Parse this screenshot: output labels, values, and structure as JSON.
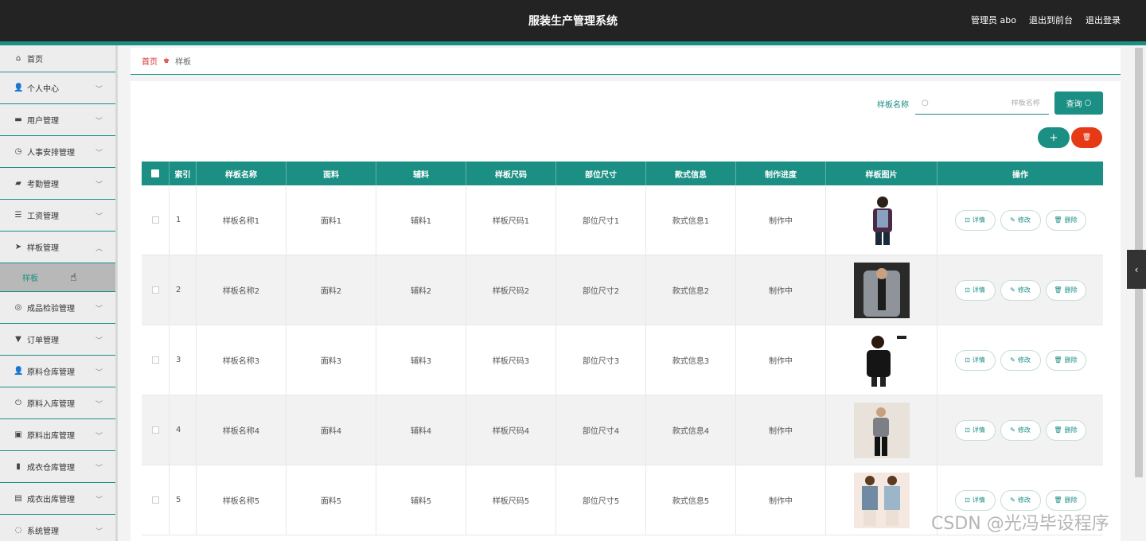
{
  "app": {
    "title": "服装生产管理系统"
  },
  "top_actions": {
    "user": "管理员 abo",
    "front": "退出到前台",
    "logout": "退出登录"
  },
  "sidebar": {
    "items": [
      {
        "label": "首页",
        "icon": "home-icon",
        "glyph": "⌂"
      },
      {
        "label": "个人中心",
        "icon": "user-icon",
        "glyph": "👤"
      },
      {
        "label": "用户管理",
        "icon": "users-icon",
        "glyph": "▬"
      },
      {
        "label": "人事安排管理",
        "icon": "clock-icon",
        "glyph": "◷"
      },
      {
        "label": "考勤管理",
        "icon": "chat-icon",
        "glyph": "▰"
      },
      {
        "label": "工资管理",
        "icon": "list-icon",
        "glyph": "☰"
      },
      {
        "label": "样板管理",
        "icon": "send-icon",
        "glyph": "➤"
      },
      {
        "label": "成品检验管理",
        "icon": "target-icon",
        "glyph": "◎"
      },
      {
        "label": "订单管理",
        "icon": "stamp-icon",
        "glyph": "▼"
      },
      {
        "label": "原料仓库管理",
        "icon": "person-icon",
        "glyph": "👤"
      },
      {
        "label": "原料入库管理",
        "icon": "power-icon",
        "glyph": "⏻"
      },
      {
        "label": "原料出库管理",
        "icon": "box-icon",
        "glyph": "▣"
      },
      {
        "label": "成衣仓库管理",
        "icon": "bar-chart-icon",
        "glyph": "▮"
      },
      {
        "label": "成衣出库管理",
        "icon": "clipboard-icon",
        "glyph": "▤"
      },
      {
        "label": "系统管理",
        "icon": "settings-icon",
        "glyph": "◌"
      }
    ],
    "sub_item": "样板"
  },
  "breadcrumb": {
    "home": "首页",
    "current": "样板"
  },
  "search": {
    "label": "样板名称",
    "placeholder": "样板名称",
    "button": "查询"
  },
  "buttons": {
    "add": "+",
    "delete": "🗑"
  },
  "table": {
    "headers": [
      "索引",
      "样板名称",
      "面料",
      "辅料",
      "样板尺码",
      "部位尺寸",
      "款式信息",
      "制作进度",
      "样板图片",
      "操作"
    ],
    "rows": [
      {
        "index": "1",
        "name": "样板名称1",
        "fabric": "面料1",
        "accessory": "辅料1",
        "size": "样板尺码1",
        "part": "部位尺寸1",
        "style": "款式信息1",
        "progress": "制作中"
      },
      {
        "index": "2",
        "name": "样板名称2",
        "fabric": "面料2",
        "accessory": "辅料2",
        "size": "样板尺码2",
        "part": "部位尺寸2",
        "style": "款式信息2",
        "progress": "制作中"
      },
      {
        "index": "3",
        "name": "样板名称3",
        "fabric": "面料3",
        "accessory": "辅料3",
        "size": "样板尺码3",
        "part": "部位尺寸3",
        "style": "款式信息3",
        "progress": "制作中"
      },
      {
        "index": "4",
        "name": "样板名称4",
        "fabric": "面料4",
        "accessory": "辅料4",
        "size": "样板尺码4",
        "part": "部位尺寸4",
        "style": "款式信息4",
        "progress": "制作中"
      },
      {
        "index": "5",
        "name": "样板名称5",
        "fabric": "面料5",
        "accessory": "辅料5",
        "size": "样板尺码5",
        "part": "部位尺寸5",
        "style": "款式信息5",
        "progress": "制作中"
      }
    ],
    "actions": {
      "detail": "详情",
      "edit": "修改",
      "delete": "删除"
    }
  },
  "watermark": "CSDN @光冯毕设程序",
  "colors": {
    "accent": "#1b8f84",
    "danger": "#e63a17",
    "topbar": "#232323"
  }
}
